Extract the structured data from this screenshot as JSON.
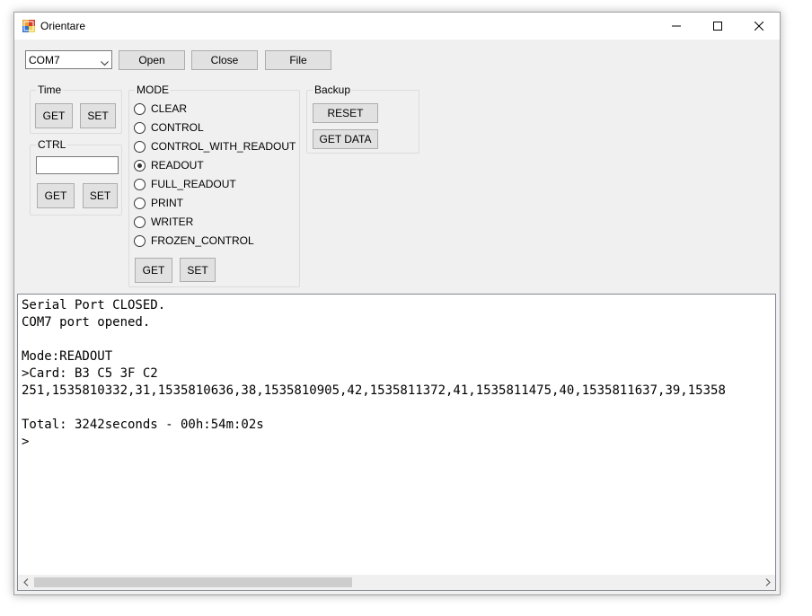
{
  "window": {
    "title": "Orientare",
    "minimize_icon": "minimize-icon",
    "maximize_icon": "maximize-icon",
    "close_icon": "close-icon"
  },
  "toolbar": {
    "port_value": "COM7",
    "open_label": "Open",
    "close_label": "Close",
    "file_label": "File"
  },
  "time_group": {
    "label": "Time",
    "get_label": "GET",
    "set_label": "SET"
  },
  "ctrl_group": {
    "label": "CTRL",
    "input_value": "",
    "get_label": "GET",
    "set_label": "SET"
  },
  "mode_group": {
    "label": "MODE",
    "options": [
      "CLEAR",
      "CONTROL",
      "CONTROL_WITH_READOUT",
      "READOUT",
      "FULL_READOUT",
      "PRINT",
      "WRITER",
      "FROZEN_CONTROL"
    ],
    "selected": "READOUT",
    "get_label": "GET",
    "set_label": "SET"
  },
  "backup_group": {
    "label": "Backup",
    "reset_label": "RESET",
    "get_data_label": "GET DATA"
  },
  "console": {
    "lines": [
      "Serial Port CLOSED.",
      "COM7 port opened.",
      "",
      "Mode:READOUT",
      ">Card: B3 C5 3F C2",
      "251,1535810332,31,1535810636,38,1535810905,42,1535811372,41,1535811475,40,1535811637,39,15358",
      "",
      "Total: 3242seconds - 00h:54m:02s",
      ">"
    ]
  }
}
